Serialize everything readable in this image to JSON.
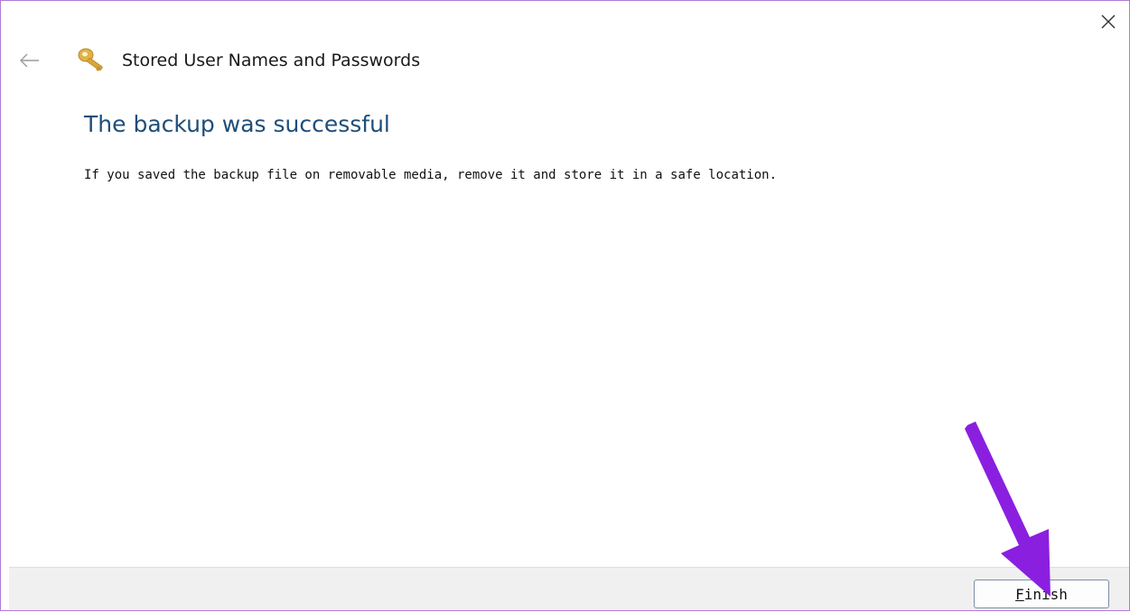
{
  "window": {
    "title": "Stored User Names and Passwords",
    "close_icon": "close-icon",
    "back_icon": "back-arrow-icon",
    "title_icon": "key-icon"
  },
  "content": {
    "heading": "The backup was successful",
    "message": "If you saved the backup file on removable media, remove it and store it in a safe location."
  },
  "footer": {
    "finish_mnemonic": "F",
    "finish_rest": "inish"
  },
  "colors": {
    "heading": "#1f4e79",
    "annotation_arrow": "#8a1fe0",
    "window_border": "#b27bd6"
  }
}
